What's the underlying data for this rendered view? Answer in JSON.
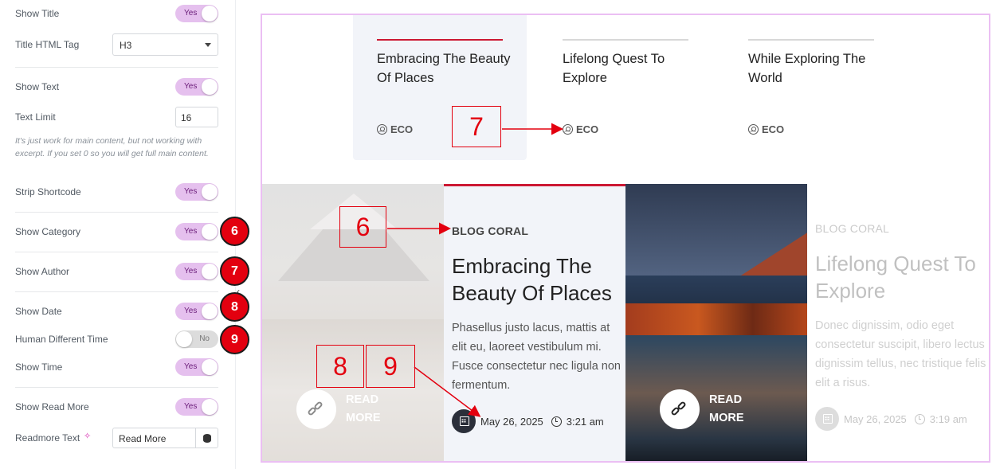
{
  "settings": {
    "show_title": {
      "label": "Show Title",
      "value": "Yes"
    },
    "title_tag": {
      "label": "Title HTML Tag",
      "value": "H3"
    },
    "show_text": {
      "label": "Show Text",
      "value": "Yes"
    },
    "text_limit": {
      "label": "Text Limit",
      "value": "16",
      "note": "It's just work for main content, but not working with excerpt. If you set 0 so you will get full main content."
    },
    "strip_shortcode": {
      "label": "Strip Shortcode",
      "value": "Yes"
    },
    "show_category": {
      "label": "Show Category",
      "value": "Yes",
      "badge": "6"
    },
    "show_author": {
      "label": "Show Author",
      "value": "Yes",
      "badge": "7"
    },
    "show_date": {
      "label": "Show Date",
      "value": "Yes",
      "badge": "8"
    },
    "human_time": {
      "label": "Human Different Time",
      "value": "No",
      "badge": "9"
    },
    "show_time": {
      "label": "Show Time",
      "value": "Yes"
    },
    "show_read_more": {
      "label": "Show Read More",
      "value": "Yes"
    },
    "readmore_text": {
      "label": "Readmore Text",
      "value": "Read More"
    }
  },
  "tabs": [
    {
      "title": "Embracing The Beauty Of Places",
      "author": "ECO",
      "active": true
    },
    {
      "title": "Lifelong Quest To Explore",
      "author": "ECO",
      "active": false
    },
    {
      "title": "While Exploring The World",
      "author": "ECO",
      "active": false
    }
  ],
  "cards": [
    {
      "category": "BLOG CORAL",
      "title": "Embracing The Beauty Of Places",
      "text": "Phasellus justo lacus, mattis at elit eu, laoreet vestibulum mi. Fusce consectetur nec ligula non fermentum.",
      "date": "May 26, 2025",
      "time": "3:21 am",
      "read_more": "READ MORE"
    },
    {
      "category": "BLOG CORAL",
      "title": "Lifelong Quest To Explore",
      "text": "Donec dignissim, odio eget consectetur suscipit, libero lectus dignissim tellus, nec tristique felis elit a risus.",
      "date": "May 26, 2025",
      "time": "3:19 am",
      "read_more": "READ MORE"
    }
  ],
  "annotations": {
    "box6": "6",
    "box7": "7",
    "box8": "8",
    "box9": "9"
  },
  "colors": {
    "accent": "#cc1833",
    "toggle_on": "#e5c0ee",
    "annotation": "#e3000f",
    "preview_border": "#ebbff3"
  },
  "icons": [
    "caret-down-icon",
    "ai-sparkle-icon",
    "database-icon",
    "user-icon",
    "calendar-icon",
    "clock-icon",
    "link-icon"
  ]
}
